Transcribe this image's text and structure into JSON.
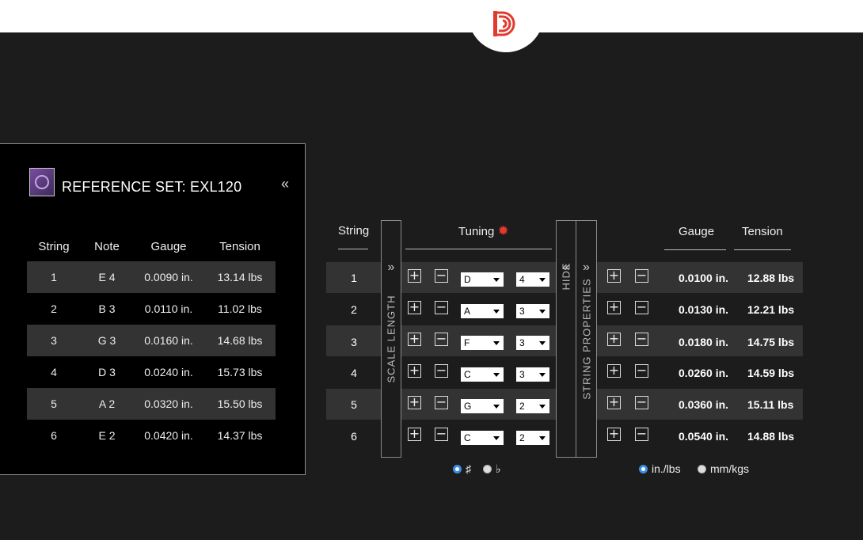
{
  "reference": {
    "title": "REFERENCE SET: EXL120",
    "collapse_icon": "«",
    "headers": [
      "String",
      "Note",
      "Gauge",
      "Tension"
    ],
    "rows": [
      [
        "1",
        "E 4",
        "0.0090 in.",
        "13.14 lbs"
      ],
      [
        "2",
        "B 3",
        "0.0110 in.",
        "11.02 lbs"
      ],
      [
        "3",
        "G 3",
        "0.0160 in.",
        "14.68 lbs"
      ],
      [
        "4",
        "D 3",
        "0.0240 in.",
        "15.73 lbs"
      ],
      [
        "5",
        "A 2",
        "0.0320 in.",
        "15.50 lbs"
      ],
      [
        "6",
        "E 2",
        "0.0420 in.",
        "14.37 lbs"
      ]
    ]
  },
  "main": {
    "headers": {
      "string": "String",
      "tuning": "Tuning",
      "gauge": "Gauge",
      "tension": "Tension"
    },
    "gear_icon": "✹",
    "plus": "+",
    "minus": "−",
    "scale_length": {
      "chevron": "»",
      "label": "SCALE LENGTH"
    },
    "hide": {
      "chevron": "«",
      "label": "HIDE"
    },
    "string_properties": {
      "chevron": "»",
      "label": "STRING PROPERTIES"
    },
    "rows": [
      {
        "string": "1",
        "note": "D",
        "octave": "4",
        "gauge": "0.0100 in.",
        "tension": "12.88 lbs"
      },
      {
        "string": "2",
        "note": "A",
        "octave": "3",
        "gauge": "0.0130 in.",
        "tension": "12.21 lbs"
      },
      {
        "string": "3",
        "note": "F",
        "octave": "3",
        "gauge": "0.0180 in.",
        "tension": "14.75 lbs"
      },
      {
        "string": "4",
        "note": "C",
        "octave": "3",
        "gauge": "0.0260 in.",
        "tension": "14.59 lbs"
      },
      {
        "string": "5",
        "note": "G",
        "octave": "2",
        "gauge": "0.0360 in.",
        "tension": "15.11 lbs"
      },
      {
        "string": "6",
        "note": "C",
        "octave": "2",
        "gauge": "0.0540 in.",
        "tension": "14.88 lbs"
      }
    ],
    "accidentals": {
      "sharp": "♯",
      "flat": "♭",
      "selected": "sharp"
    },
    "units": {
      "imperial": "in./lbs",
      "metric": "mm/kgs",
      "selected": "imperial"
    }
  },
  "colors": {
    "brand_red": "#e23b2e",
    "background": "#1c1c1c",
    "row_shade": "#333333",
    "radio_accent": "#3a8ee6"
  }
}
